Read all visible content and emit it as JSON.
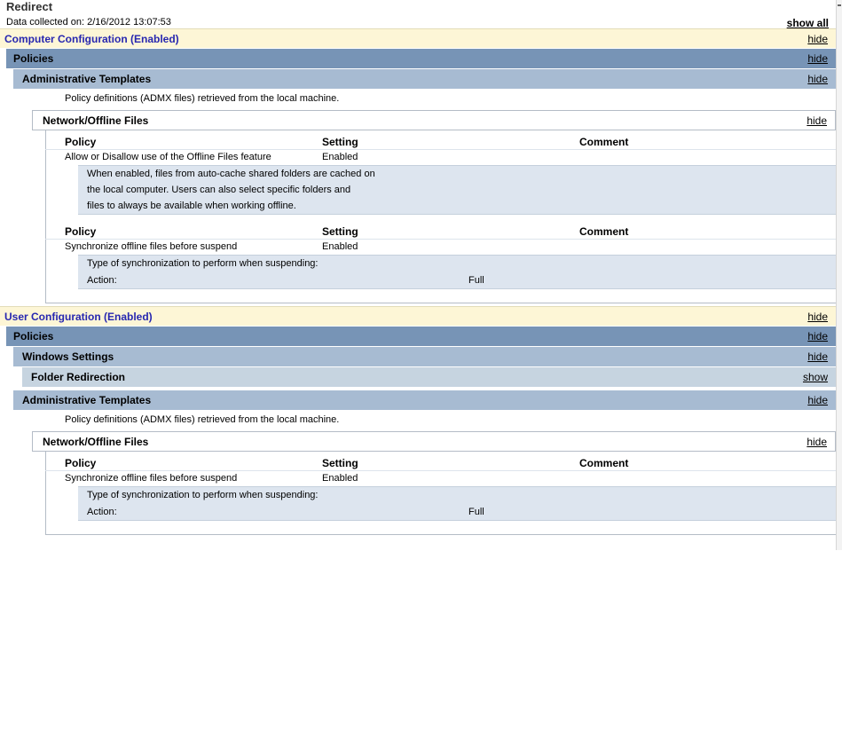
{
  "page": {
    "title": "Redirect",
    "collected": "Data collected on: 2/16/2012 13:07:53",
    "show_all": "show all"
  },
  "computer": {
    "header": "Computer Configuration (Enabled)",
    "toggle": "hide",
    "policies": {
      "label": "Policies",
      "toggle": "hide"
    },
    "admin": {
      "label": "Administrative Templates",
      "toggle": "hide",
      "note": "Policy definitions (ADMX files) retrieved from the local machine.",
      "network": {
        "label": "Network/Offline Files",
        "toggle": "hide",
        "tables": [
          {
            "cols": [
              "Policy",
              "Setting",
              "Comment"
            ],
            "policy": "Allow or Disallow use of the Offline Files feature",
            "setting": "Enabled",
            "desc": [
              "When enabled, files from auto-cache shared folders are cached on",
              "the local computer. Users can also select specific folders and",
              "files to always be available when working offline."
            ]
          },
          {
            "cols": [
              "Policy",
              "Setting",
              "Comment"
            ],
            "policy": "Synchronize offline files before suspend",
            "setting": "Enabled",
            "desc_line": "Type of synchronization to perform when suspending:",
            "action_label": "Action:",
            "action_value": "Full"
          }
        ]
      }
    }
  },
  "user": {
    "header": "User Configuration (Enabled)",
    "toggle": "hide",
    "policies": {
      "label": "Policies",
      "toggle": "hide"
    },
    "windows": {
      "label": "Windows Settings",
      "toggle": "hide"
    },
    "folder": {
      "label": "Folder Redirection",
      "toggle": "show"
    },
    "admin": {
      "label": "Administrative Templates",
      "toggle": "hide",
      "note": "Policy definitions (ADMX files) retrieved from the local machine.",
      "network": {
        "label": "Network/Offline Files",
        "toggle": "hide",
        "table": {
          "cols": [
            "Policy",
            "Setting",
            "Comment"
          ],
          "policy": "Synchronize offline files before suspend",
          "setting": "Enabled",
          "desc_line": "Type of synchronization to perform when suspending:",
          "action_label": "Action:",
          "action_value": "Full"
        }
      }
    }
  }
}
